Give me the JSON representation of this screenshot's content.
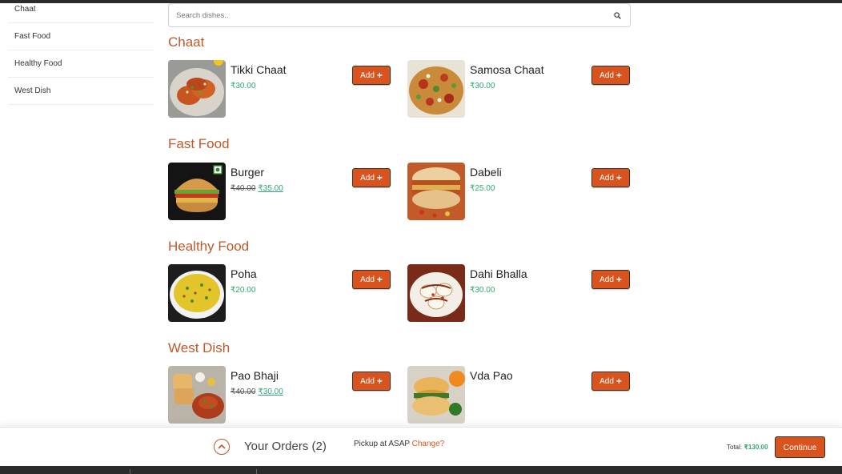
{
  "sidebar": {
    "items": [
      {
        "label": "Chaat"
      },
      {
        "label": "Fast Food"
      },
      {
        "label": "Healthy Food"
      },
      {
        "label": "West Dish"
      }
    ]
  },
  "search": {
    "placeholder": "Search dishes.."
  },
  "categories": [
    {
      "title": "Chaat",
      "items": [
        {
          "name": "Tikki Chaat",
          "price": "₹30.00",
          "add_label": "Add"
        },
        {
          "name": "Samosa Chaat",
          "price": "₹30.00",
          "add_label": "Add"
        }
      ]
    },
    {
      "title": "Fast Food",
      "items": [
        {
          "name": "Burger",
          "old_price": "₹40.00",
          "price": "₹35.00",
          "add_label": "Add"
        },
        {
          "name": "Dabeli",
          "price": "₹25.00",
          "add_label": "Add"
        }
      ]
    },
    {
      "title": "Healthy Food",
      "items": [
        {
          "name": "Poha",
          "price": "₹20.00",
          "add_label": "Add"
        },
        {
          "name": "Dahi Bhalla",
          "price": "₹30.00",
          "add_label": "Add"
        }
      ]
    },
    {
      "title": "West Dish",
      "items": [
        {
          "name": "Pao Bhaji",
          "old_price": "₹40.00",
          "price": "₹30.00",
          "add_label": "Add"
        },
        {
          "name": "Vda Pao",
          "price": "",
          "add_label": "Add"
        }
      ]
    }
  ],
  "bottom_bar": {
    "orders_label": "Your Orders (2)",
    "pickup_text": "Pickup at ASAP",
    "change_label": "Change?",
    "total_label": "Total:",
    "total_value": "₹130.00",
    "continue_label": "Continue"
  },
  "colors": {
    "accent": "#d9531e",
    "category_title": "#c1592a",
    "price_green": "#2fa870"
  },
  "icons": {
    "search": "search-icon",
    "orders_toggle": "chevron-up-icon",
    "add": "plus-icon",
    "veg_mark": "veg-mark-icon"
  }
}
